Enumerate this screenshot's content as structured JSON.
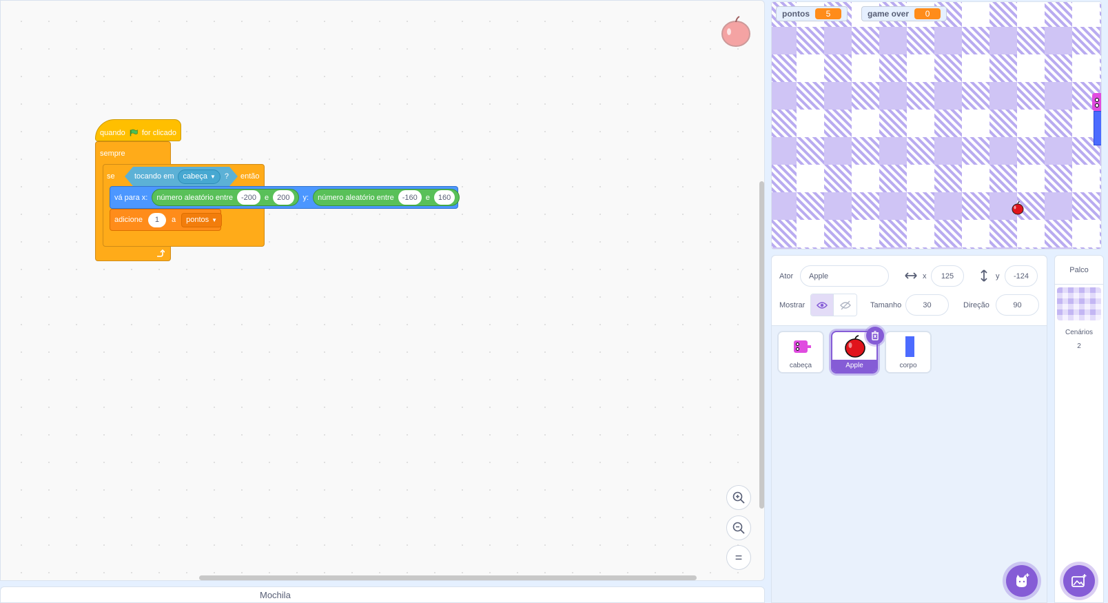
{
  "code_area": {
    "hat_block": {
      "prefix": "quando",
      "suffix": "for clicado",
      "flag_icon": "green-flag-icon"
    },
    "forever_block": {
      "label": "sempre"
    },
    "if_block": {
      "if_label": "se",
      "then_label": "então"
    },
    "touching_block": {
      "label": "tocando em",
      "target": "cabeça",
      "question": "?"
    },
    "goto_block": {
      "label": "vá para x:",
      "y_label": "y:"
    },
    "random_x": {
      "label": "número aleatório entre",
      "from": "-200",
      "and": "e",
      "to": "200"
    },
    "random_y": {
      "label": "número aleatório entre",
      "from": "-160",
      "and": "e",
      "to": "160"
    },
    "change_block": {
      "label": "adicione",
      "amount": "1",
      "to_label": "a",
      "variable": "pontos"
    },
    "zoom_in_icon": "zoom-in-icon",
    "zoom_out_icon": "zoom-out-icon",
    "zoom_reset_label": "="
  },
  "backpack": {
    "label": "Mochila"
  },
  "stage": {
    "monitors": [
      {
        "name": "pontos",
        "value": "5"
      },
      {
        "name": "game over",
        "value": "0"
      }
    ],
    "checker_colors": [
      "#b7a8f0",
      "#ffffff"
    ]
  },
  "sprite_info": {
    "sprite_label": "Ator",
    "sprite_name": "Apple",
    "x_label": "x",
    "x_value": "125",
    "y_label": "y",
    "y_value": "-124",
    "show_label": "Mostrar",
    "size_label": "Tamanho",
    "size_value": "30",
    "direction_label": "Direção",
    "direction_value": "90"
  },
  "sprites": [
    {
      "name": "cabeça",
      "selected": false
    },
    {
      "name": "Apple",
      "selected": true
    },
    {
      "name": "corpo",
      "selected": false
    }
  ],
  "stage_pane": {
    "title": "Palco",
    "backdrops_label": "Cenários",
    "backdrops_count": "2"
  },
  "colors": {
    "accent": "#855cd6",
    "events": "#ffbf00",
    "control": "#ffab19",
    "motion": "#4c97ff",
    "operators": "#59c059",
    "sensing": "#5cb1d6",
    "variables": "#ff8c1a"
  }
}
